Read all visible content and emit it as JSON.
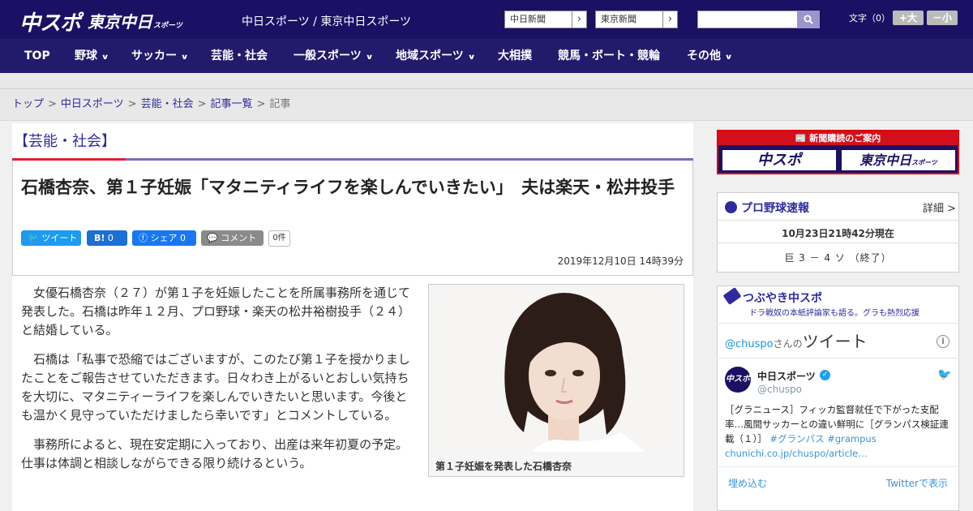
{
  "header": {
    "logo_main": "中スポ",
    "logo_tokyo": "東京中日",
    "logo_tokyo_small": "スポーツ",
    "site_names": "中日スポーツ / 東京中日スポーツ",
    "link1": "中日新聞",
    "link2": "東京新聞",
    "link_arrow": "›",
    "search_placeholder": "",
    "fontsize_label": "文字（0）",
    "font_bigger": "+大",
    "font_smaller": "－小",
    "colors": {
      "bar": "#1a1165",
      "nav": "#221a6b",
      "accent_red": "#e02030"
    }
  },
  "nav": {
    "items": [
      {
        "label": "TOP",
        "chev": ""
      },
      {
        "label": "野球",
        "chev": "∨"
      },
      {
        "label": "サッカー",
        "chev": "∨"
      },
      {
        "label": "芸能・社会",
        "chev": ""
      },
      {
        "label": "一般スポーツ",
        "chev": "∨"
      },
      {
        "label": "地域スポーツ",
        "chev": "∨"
      },
      {
        "label": "大相撲",
        "chev": ""
      },
      {
        "label": "競馬・ボート・競輪",
        "chev": ""
      },
      {
        "label": "その他",
        "chev": "∨"
      }
    ]
  },
  "breadcrumb": {
    "items": [
      "トップ",
      "中日スポーツ",
      "芸能・社会",
      "記事一覧"
    ],
    "current": "記事",
    "sep": ">"
  },
  "article": {
    "category": "【芸能・社会】",
    "headline": "石橋杏奈、第１子妊娠「マタニティライフを楽しんでいきたい」　夫は楽天・松井投手",
    "share": {
      "tweet": "ツイート",
      "hatena": "B!",
      "hatena_count": "0",
      "facebook": "シェア",
      "facebook_count": "0",
      "comment": "コメント",
      "comment_count": "0件"
    },
    "datetime": "2019年12月10日 14時39分",
    "paragraphs": [
      "女優石橋杏奈（２７）が第１子を妊娠したことを所属事務所を通じて発表した。石橋は昨年１２月、プロ野球・楽天の松井裕樹投手（２４）と結婚している。",
      "石橋は「私事で恐縮ではございますが、このたび第１子を授かりましたことをご報告させていただきます。日々わき上がるいとおしい気持ちを大切に、マタニティーライフを楽しんでいきたいと思います。今後とも温かく見守っていただけましたら幸いです」とコメントしている。",
      "事務所によると、現在安定期に入っており、出産は来年初夏の予定。仕事は体調と相談しながらできる限り続けるという。"
    ],
    "photo_caption": "第１子妊娠を発表した石橋杏奈"
  },
  "sidebar": {
    "banner_title": "新聞購読のご案内",
    "banner_chuspo": "中スポ",
    "banner_tokyo": "東京中日",
    "banner_tokyo_small": "スポーツ",
    "baseball": {
      "title": "プロ野球速報",
      "detail": "詳細 >",
      "time": "10月23日21時42分現在",
      "score": "巨 3 － 4 ソ （終了）"
    },
    "tsubuyaki": {
      "title": "つぶやき中スポ",
      "subtitle": "ドラ戦奴の本紙評論家も語る。グラも熱烈応援",
      "header_handle": "@chuspo",
      "header_san": "さんの",
      "header_tweet": "ツイート",
      "info": "i",
      "account_name": "中日スポーツ",
      "verified": "✓",
      "handle": "@chuspo",
      "avatar_text": "中スポ",
      "bird": "🐦",
      "tweet_text": "［グラニュース］フィッカ監督就任で下がった支配率…風間サッカーとの違い鮮明に［グランパス検証連載（１）］",
      "tag1": "#グランパス",
      "tag2": "#grampus",
      "link": "chunichi.co.jp/chuspo/article…",
      "embed": "埋め込む",
      "view": "Twitterで表示"
    }
  }
}
